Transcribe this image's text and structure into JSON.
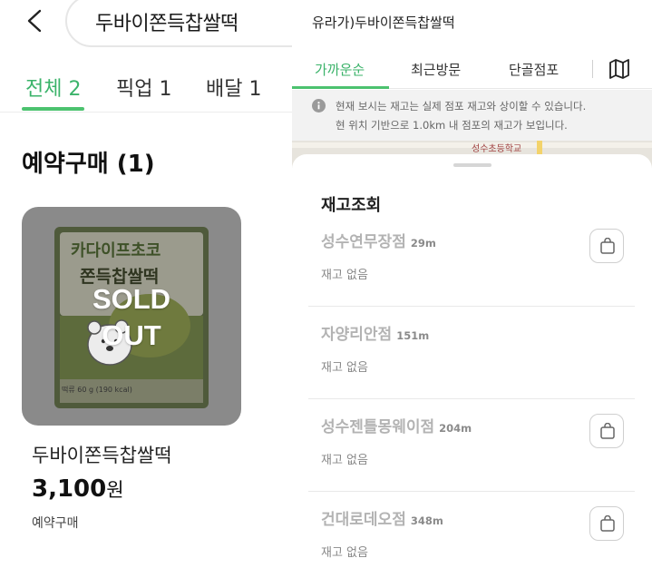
{
  "left": {
    "search": {
      "query": "두바이쫀득찹쌀떡",
      "back_icon": "chevron-left-icon"
    },
    "tabs": [
      {
        "label": "전체 2",
        "active": true
      },
      {
        "label": "픽업 1",
        "active": false
      },
      {
        "label": "배달 1",
        "active": false
      }
    ],
    "section_title": "예약구매 (1)",
    "product": {
      "package_text_1": "카다이프초코",
      "package_text_2": "쫀득찹쌀떡",
      "package_weight": "떡류 60 g (190 kcal)",
      "badge_line1": "SOLD",
      "badge_line2": "OUT",
      "name": "두바이쫀득찹쌀떡",
      "price": "3,100",
      "currency": "원",
      "purchase_type": "예약구매"
    }
  },
  "right": {
    "store_title": "유라가)두바이쫀득찹쌀떡",
    "tabs": [
      {
        "label": "가까운순",
        "active": true
      },
      {
        "label": "최근방문",
        "active": false
      },
      {
        "label": "단골점포",
        "active": false
      }
    ],
    "map_icon": "map-icon",
    "notice": {
      "icon": "info-icon",
      "line1": "현재 보시는 재고는 실제 점포 재고와 상이할 수 있습니다.",
      "line2": "현 위치 기반으로 1.0km 내 점포의 재고가 보입니다."
    },
    "map_label": "성수초등학교",
    "sheet_title": "재고조회",
    "stores": [
      {
        "name": "성수연무장점",
        "distance": "29m",
        "stock": "재고 없음",
        "has_bag": true
      },
      {
        "name": "자양리안점",
        "distance": "151m",
        "stock": "재고 없음",
        "has_bag": false
      },
      {
        "name": "성수젠틀몽웨이점",
        "distance": "204m",
        "stock": "재고 없음",
        "has_bag": true
      },
      {
        "name": "건대로데오점",
        "distance": "348m",
        "stock": "재고 없음",
        "has_bag": true
      }
    ]
  },
  "colors": {
    "accent": "#4cc26f",
    "sold_out_overlay": "#8a8a8a",
    "muted_store": "#b3b3b3"
  }
}
